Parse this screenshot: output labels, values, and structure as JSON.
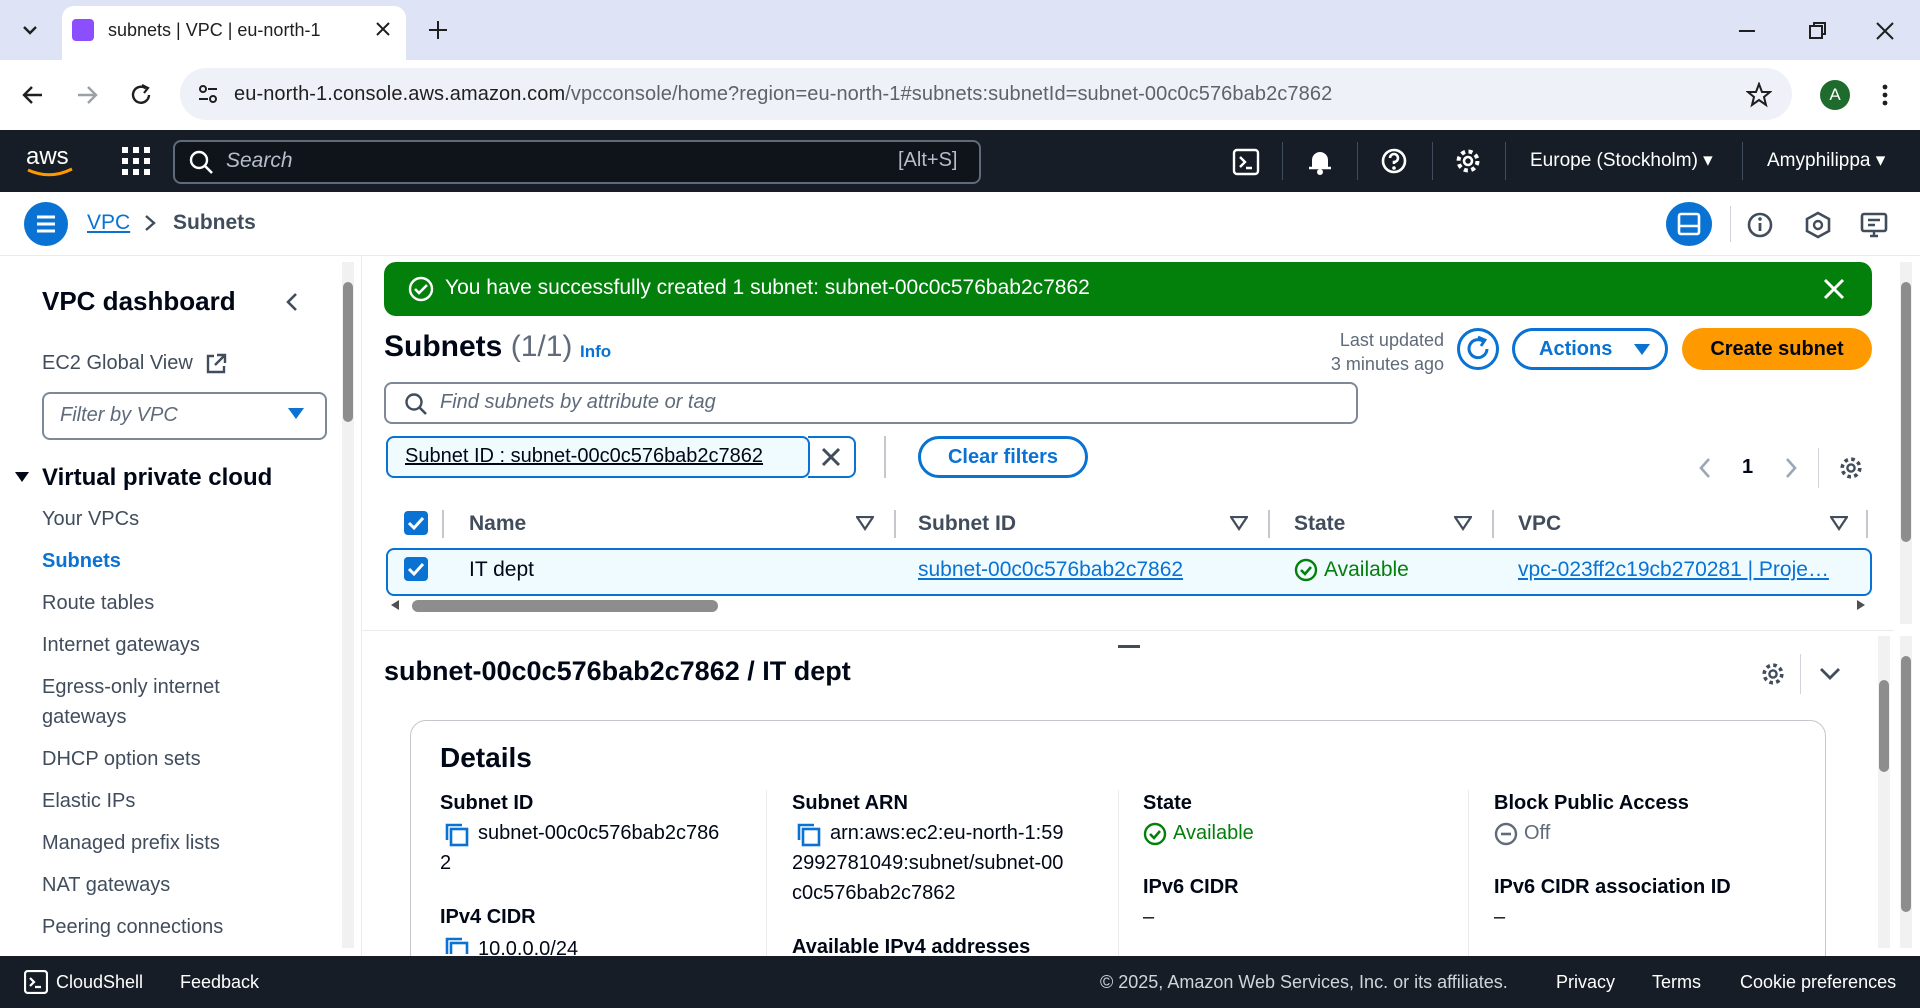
{
  "browser": {
    "tab_title": "subnets | VPC | eu-north-1",
    "url_host": "eu-north-1.console.aws.amazon.com",
    "url_path": "/vpcconsole/home?region=eu-north-1#subnets:subnetId=subnet-00c0c576bab2c7862",
    "profile_initial": "A"
  },
  "topnav": {
    "search_placeholder": "Search",
    "search_shortcut": "[Alt+S]",
    "region": "Europe (Stockholm)",
    "account": "Amyphilippa"
  },
  "breadcrumb": {
    "root": "VPC",
    "current": "Subnets"
  },
  "sidebar": {
    "title": "VPC dashboard",
    "global_view": "EC2 Global View",
    "filter_placeholder": "Filter by VPC",
    "section": "Virtual private cloud",
    "items": [
      {
        "label": "Your VPCs",
        "active": false
      },
      {
        "label": "Subnets",
        "active": true
      },
      {
        "label": "Route tables",
        "active": false
      },
      {
        "label": "Internet gateways",
        "active": false
      },
      {
        "label": "Egress-only internet",
        "active": false
      },
      {
        "label": "gateways",
        "active": false
      },
      {
        "label": "DHCP option sets",
        "active": false
      },
      {
        "label": "Elastic IPs",
        "active": false
      },
      {
        "label": "Managed prefix lists",
        "active": false
      },
      {
        "label": "NAT gateways",
        "active": false
      },
      {
        "label": "Peering connections",
        "active": false
      }
    ]
  },
  "flash": {
    "message": "You have successfully created 1 subnet: subnet-00c0c576bab2c7862"
  },
  "list": {
    "title": "Subnets",
    "count": "(1/1)",
    "info": "Info",
    "last_updated_label": "Last updated",
    "last_updated_value": "3 minutes ago",
    "actions_label": "Actions",
    "create_label": "Create subnet",
    "find_placeholder": "Find subnets by attribute or tag",
    "filter_token": "Subnet ID : subnet-00c0c576bab2c7862",
    "clear_filters": "Clear filters",
    "page": "1",
    "columns": [
      "Name",
      "Subnet ID",
      "State",
      "VPC"
    ],
    "rows": [
      {
        "name": "IT dept",
        "subnet_id": "subnet-00c0c576bab2c7862",
        "state": "Available",
        "vpc": "vpc-023ff2c19cb270281 | Proje…"
      }
    ]
  },
  "detail": {
    "heading": "subnet-00c0c576bab2c7862 / IT dept",
    "card_title": "Details",
    "subnet_id_label": "Subnet ID",
    "subnet_id_value_line1": "subnet-00c0c576bab2c786",
    "subnet_id_value_line2": "2",
    "ipv4_cidr_label": "IPv4 CIDR",
    "ipv4_cidr_value": "10.0.0.0/24",
    "arn_label": "Subnet ARN",
    "arn_value_line1": "arn:aws:ec2:eu-north-1:59",
    "arn_value_line2": "2992781049:subnet/subnet-00",
    "arn_value_line3": "c0c576bab2c7862",
    "available_ipv4_label": "Available IPv4 addresses",
    "state_label": "State",
    "state_value": "Available",
    "ipv6_cidr_label": "IPv6 CIDR",
    "ipv6_cidr_value": "–",
    "bpa_label": "Block Public Access",
    "bpa_value": "Off",
    "ipv6_assoc_label": "IPv6 CIDR association ID",
    "ipv6_assoc_value": "–"
  },
  "footer": {
    "cloudshell": "CloudShell",
    "feedback": "Feedback",
    "copyright": "© 2025, Amazon Web Services, Inc. or its affiliates.",
    "privacy": "Privacy",
    "terms": "Terms",
    "cookies": "Cookie preferences"
  },
  "colors": {
    "aws_nav": "#161d26",
    "link_blue": "#0972d3",
    "success_green": "#037f0c",
    "primary_orange": "#ff9900"
  }
}
